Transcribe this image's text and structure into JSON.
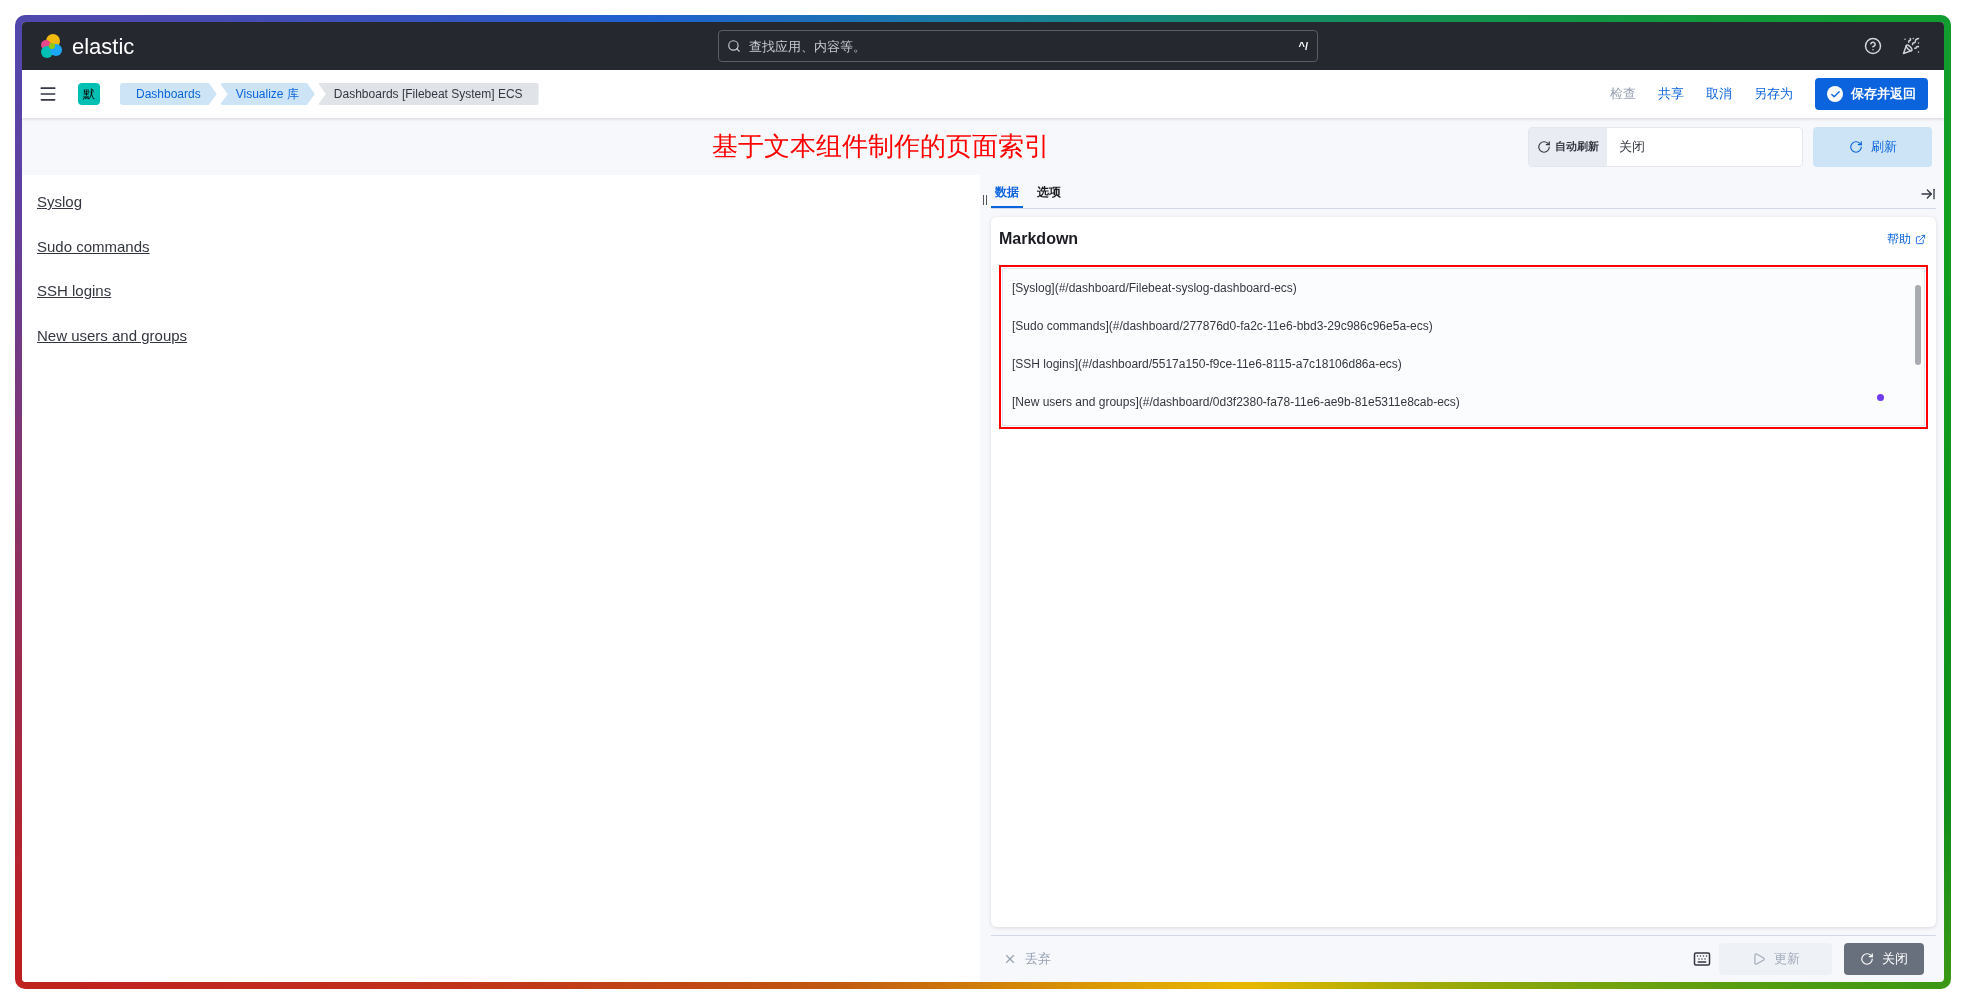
{
  "header": {
    "logo": "elastic",
    "search": {
      "placeholder": "查找应用、内容等。",
      "shortcut": "^/"
    }
  },
  "nav": {
    "space_badge": "默",
    "breadcrumbs": [
      {
        "label": "Dashboards",
        "kind": "link"
      },
      {
        "label": "Visualize 库",
        "kind": "link"
      },
      {
        "label": "Dashboards [Filebeat System] ECS",
        "kind": "current"
      }
    ],
    "actions": [
      {
        "label": "检查",
        "disabled": true
      },
      {
        "label": "共享",
        "disabled": false
      },
      {
        "label": "取消",
        "disabled": false
      },
      {
        "label": "另存为",
        "disabled": false
      }
    ],
    "primary_button": "保存并返回"
  },
  "title": "基于文本组件制作的页面索引",
  "refresh": {
    "label": "自动刷新",
    "value": "关闭",
    "button": "刷新"
  },
  "links": [
    "Syslog",
    "Sudo commands",
    "SSH logins",
    "New users and groups"
  ],
  "editor": {
    "tabs": [
      {
        "label": "数据",
        "selected": true
      },
      {
        "label": "选项",
        "selected": false
      }
    ],
    "card_title": "Markdown",
    "help": "帮助",
    "lines": [
      "[Syslog](#/dashboard/Filebeat-syslog-dashboard-ecs)",
      "[Sudo commands](#/dashboard/277876d0-fa2c-11e6-bbd3-29c986c96e5a-ecs)",
      "[SSH logins](#/dashboard/5517a150-f9ce-11e6-8115-a7c18106d86a-ecs)",
      "[New users and groups](#/dashboard/0d3f2380-fa78-11e6-ae9b-81e5311e8cab-ecs)"
    ]
  },
  "footer": {
    "discard": "丢弃",
    "update": {
      "label": "更新",
      "disabled": true
    },
    "close": "关闭"
  }
}
